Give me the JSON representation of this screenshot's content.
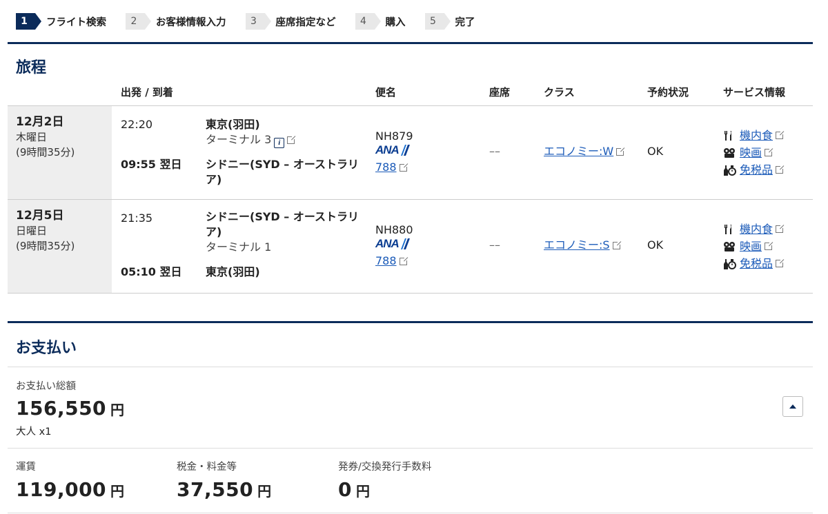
{
  "steps": [
    {
      "num": "1",
      "label": "フライト検索",
      "active": true
    },
    {
      "num": "2",
      "label": "お客様情報入力",
      "active": false
    },
    {
      "num": "3",
      "label": "座席指定など",
      "active": false
    },
    {
      "num": "4",
      "label": "購入",
      "active": false
    },
    {
      "num": "5",
      "label": "完了",
      "active": false
    }
  ],
  "itinerary": {
    "title": "旅程",
    "headers": {
      "depart_arrive": "出発 / 到着",
      "flight": "便名",
      "seat": "座席",
      "class": "クラス",
      "status": "予約状況",
      "service": "サービス情報"
    },
    "rows": [
      {
        "date": "12月2日",
        "weekday": "木曜日",
        "duration": "(9時間35分)",
        "dep_time": "22:20",
        "dep_city": "東京(羽田)",
        "dep_terminal": "ターミナル 3",
        "arr_time": "09:55 翌日",
        "arr_city": "シドニー(SYD – オーストラリア)",
        "arr_terminal": "",
        "flight_no": "NH879",
        "airline_logo": "ANA",
        "aircraft": "788",
        "seat": "––",
        "class": "エコノミー:W",
        "status": "OK",
        "services": [
          "機内食",
          "映画",
          "免税品"
        ]
      },
      {
        "date": "12月5日",
        "weekday": "日曜日",
        "duration": "(9時間35分)",
        "dep_time": "21:35",
        "dep_city": "シドニー(SYD – オーストラリア)",
        "dep_terminal": "ターミナル 1",
        "arr_time": "05:10 翌日",
        "arr_city": "東京(羽田)",
        "arr_terminal": "",
        "flight_no": "NH880",
        "airline_logo": "ANA",
        "aircraft": "788",
        "seat": "––",
        "class": "エコノミー:S",
        "status": "OK",
        "services": [
          "機内食",
          "映画",
          "免税品"
        ]
      }
    ]
  },
  "payment": {
    "title": "お支払い",
    "total_label": "お支払い総額",
    "total_amount": "156,550",
    "currency": "円",
    "passengers": "大人 x1",
    "fare_label": "運賃",
    "fare_amount": "119,000",
    "tax_label": "税金・料金等",
    "tax_amount": "37,550",
    "fee_label": "発券/交換発行手数料",
    "fee_amount": "0"
  },
  "colors": {
    "brand": "#0b2b5a",
    "link": "#1a5ab8"
  }
}
